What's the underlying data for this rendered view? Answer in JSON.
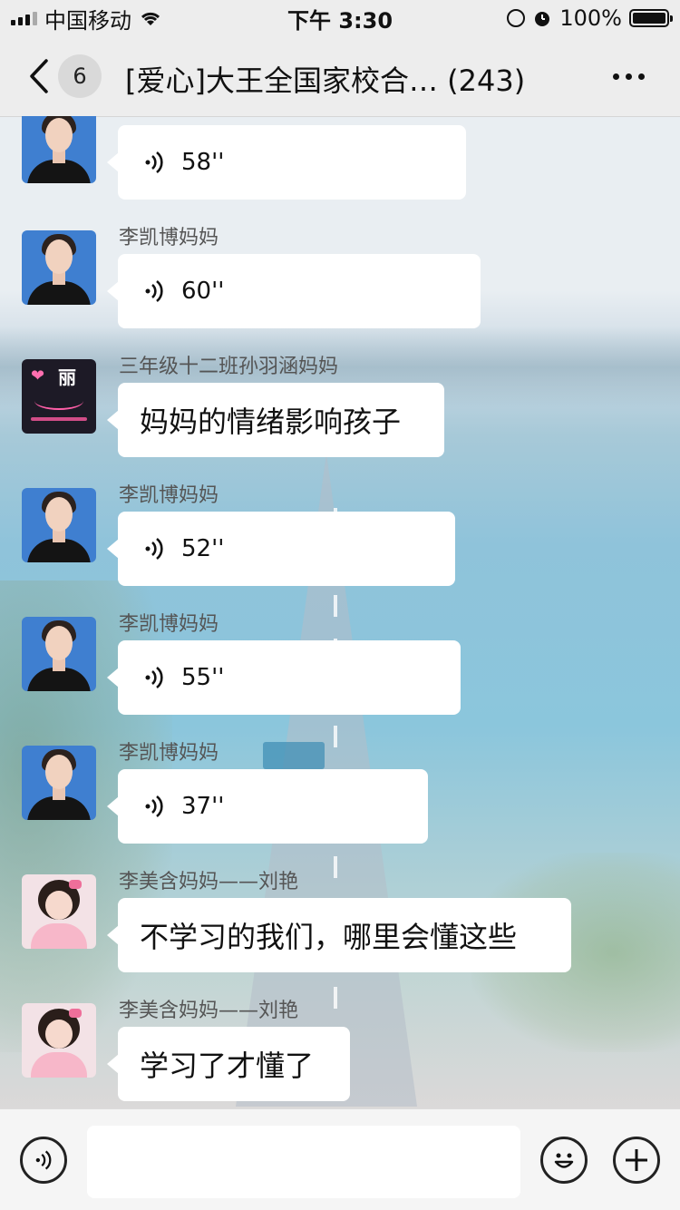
{
  "status_bar": {
    "carrier": "中国移动",
    "time": "下午 3:30",
    "battery": "100%"
  },
  "nav": {
    "unread_count": "6",
    "title": "[爱心]大王全国家校合…",
    "member_count": "(243)"
  },
  "messages": [
    {
      "sender": "",
      "type": "voice",
      "text": "58''",
      "avatar": "id-photo"
    },
    {
      "sender": "李凯博妈妈",
      "type": "voice",
      "text": "60''",
      "avatar": "id-photo"
    },
    {
      "sender": "三年级十二班孙羽涵妈妈",
      "type": "text",
      "text": "妈妈的情绪影响孩子",
      "avatar": "dark-logo"
    },
    {
      "sender": "李凯博妈妈",
      "type": "voice",
      "text": "52''",
      "avatar": "id-photo"
    },
    {
      "sender": "李凯博妈妈",
      "type": "voice",
      "text": "55''",
      "avatar": "id-photo"
    },
    {
      "sender": "李凯博妈妈",
      "type": "voice",
      "text": "37''",
      "avatar": "id-photo"
    },
    {
      "sender": "李美含妈妈——刘艳",
      "type": "text",
      "text": "不学习的我们，哪里会懂这些",
      "avatar": "girl-photo"
    },
    {
      "sender": "李美含妈妈——刘艳",
      "type": "text",
      "text": "学习了才懂了",
      "avatar": "girl-photo"
    }
  ],
  "input_bar": {
    "placeholder": "",
    "icons": [
      "voice-icon",
      "emoji-icon",
      "plus-icon"
    ]
  },
  "colors": {
    "bubble": "#ffffff",
    "bar": "#ededed",
    "text": "#111111",
    "sender": "#555555"
  }
}
